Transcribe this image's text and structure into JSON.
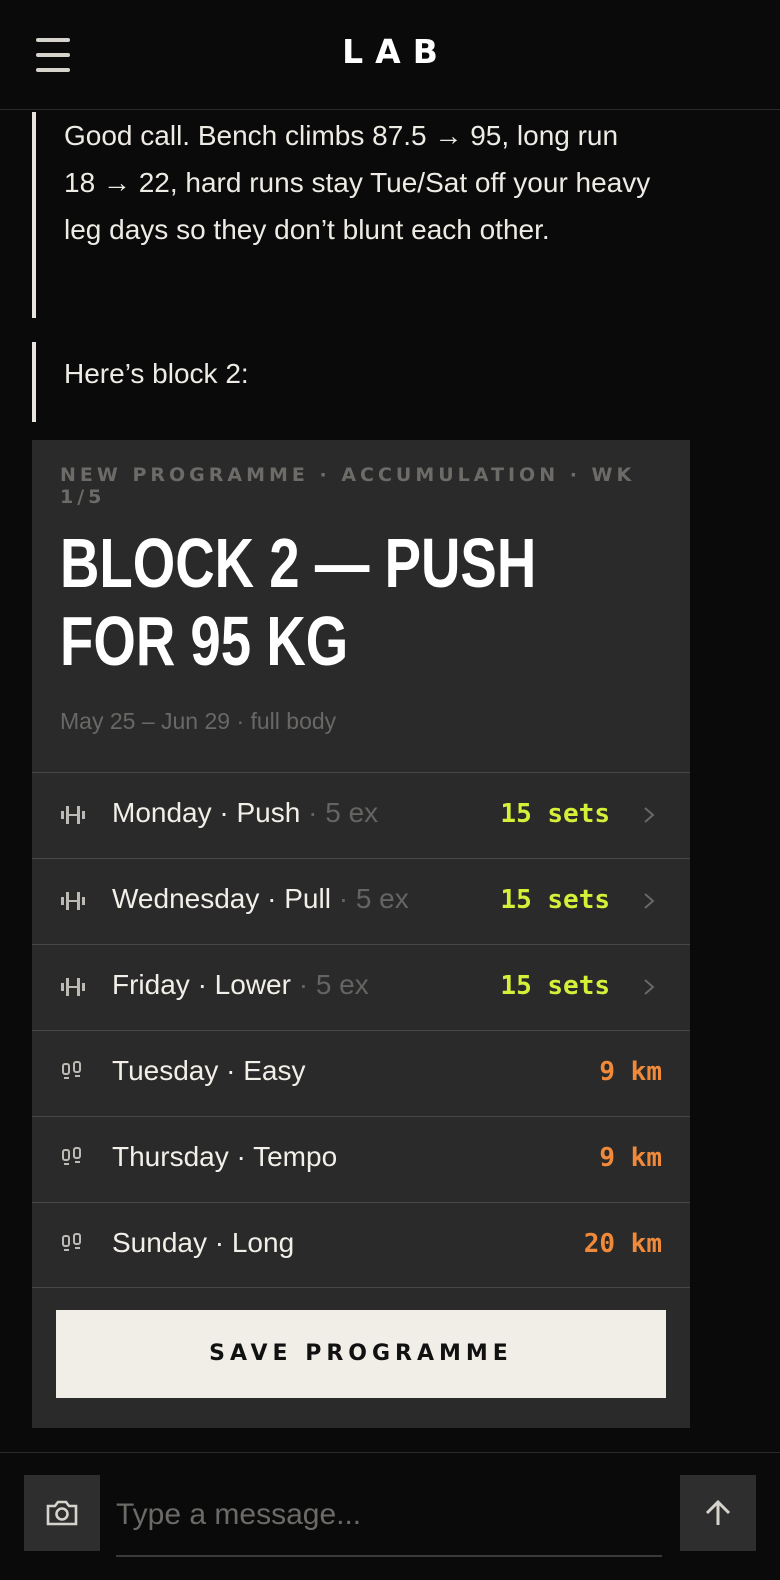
{
  "header": {
    "logo": "LAB",
    "menu_icon": "hamburger-menu-icon"
  },
  "messages": [
    {
      "text": "Good call. Bench climbs 87.5 → 95, long run 18 → 22, hard runs stay Tue/Sat off your heavy leg days so they don’t blunt each other."
    },
    {
      "text": "Here’s block 2:"
    }
  ],
  "card": {
    "eyebrow": "NEW PROGRAMME · ACCUMULATION · WK 1/5",
    "title": "BLOCK 2 — PUSH FOR 95 KG",
    "meta": "May 25 – Jun 29 · full body",
    "strength_rows": [
      {
        "label": "Monday · Push",
        "ex": " · 5 ex",
        "value": "15 sets",
        "icon": "barbell-icon"
      },
      {
        "label": "Wednesday · Pull",
        "ex": " · 5 ex",
        "value": "15 sets",
        "icon": "barbell-icon"
      },
      {
        "label": "Friday · Lower",
        "ex": " · 5 ex",
        "value": "15 sets",
        "icon": "barbell-icon"
      }
    ],
    "run_rows": [
      {
        "label": "Tuesday · Easy",
        "value": "9 km",
        "icon": "footprints-icon"
      },
      {
        "label": "Thursday · Tempo",
        "value": "9 km",
        "icon": "footprints-icon"
      },
      {
        "label": "Sunday · Long",
        "value": "20 km",
        "icon": "footprints-icon"
      }
    ],
    "save_label": "SAVE PROGRAMME"
  },
  "composer": {
    "placeholder": "Type a message...",
    "camera_icon": "camera-icon",
    "send_icon": "arrow-up-icon"
  },
  "colors": {
    "background": "#0a0a0a",
    "card": "#2a2a2a",
    "sets_accent": "#d6f03a",
    "distance_accent": "#f08a3a",
    "button": "#f1eee7"
  }
}
